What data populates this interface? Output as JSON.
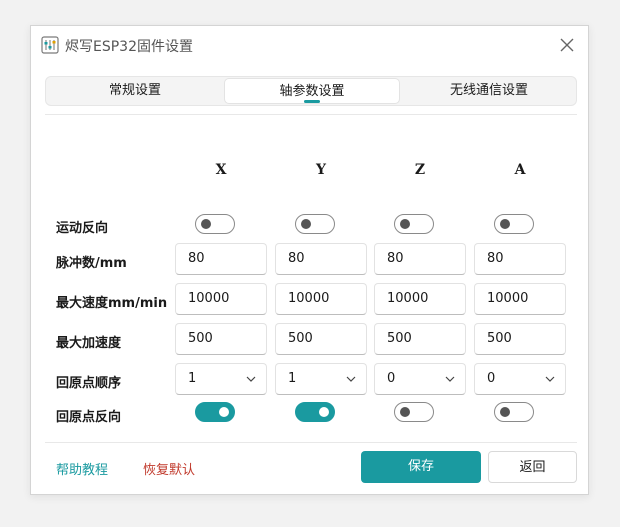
{
  "window": {
    "title": "烬写ESP32固件设置"
  },
  "tabs": [
    {
      "label": "常规设置",
      "active": false
    },
    {
      "label": "轴参数设置",
      "active": true
    },
    {
      "label": "无线通信设置",
      "active": false
    }
  ],
  "axes": [
    "X",
    "Y",
    "Z",
    "A"
  ],
  "rows": {
    "motion_reverse": {
      "label": "运动反向",
      "values": [
        false,
        false,
        false,
        false
      ]
    },
    "pulses": {
      "label": "脉冲数/mm",
      "values": [
        "80",
        "80",
        "80",
        "80"
      ]
    },
    "max_speed": {
      "label": "最大速度mm/min",
      "values": [
        "10000",
        "10000",
        "10000",
        "10000"
      ]
    },
    "max_accel": {
      "label": "最大加速度",
      "values": [
        "500",
        "500",
        "500",
        "500"
      ]
    },
    "homing_order": {
      "label": "回原点顺序",
      "values": [
        "1",
        "1",
        "0",
        "0"
      ]
    },
    "homing_reverse": {
      "label": "回原点反向",
      "values": [
        true,
        true,
        false,
        false
      ]
    }
  },
  "footer": {
    "help_label": "帮助教程",
    "reset_label": "恢复默认",
    "save_label": "保存",
    "back_label": "返回"
  },
  "colors": {
    "accent": "#1a9aa0",
    "help_link": "#1a9aa0",
    "reset_link": "#c0392b"
  },
  "icons": {
    "app": "app-settings-icon",
    "close": "close-icon",
    "dropdown": "chevron-down-icon"
  }
}
